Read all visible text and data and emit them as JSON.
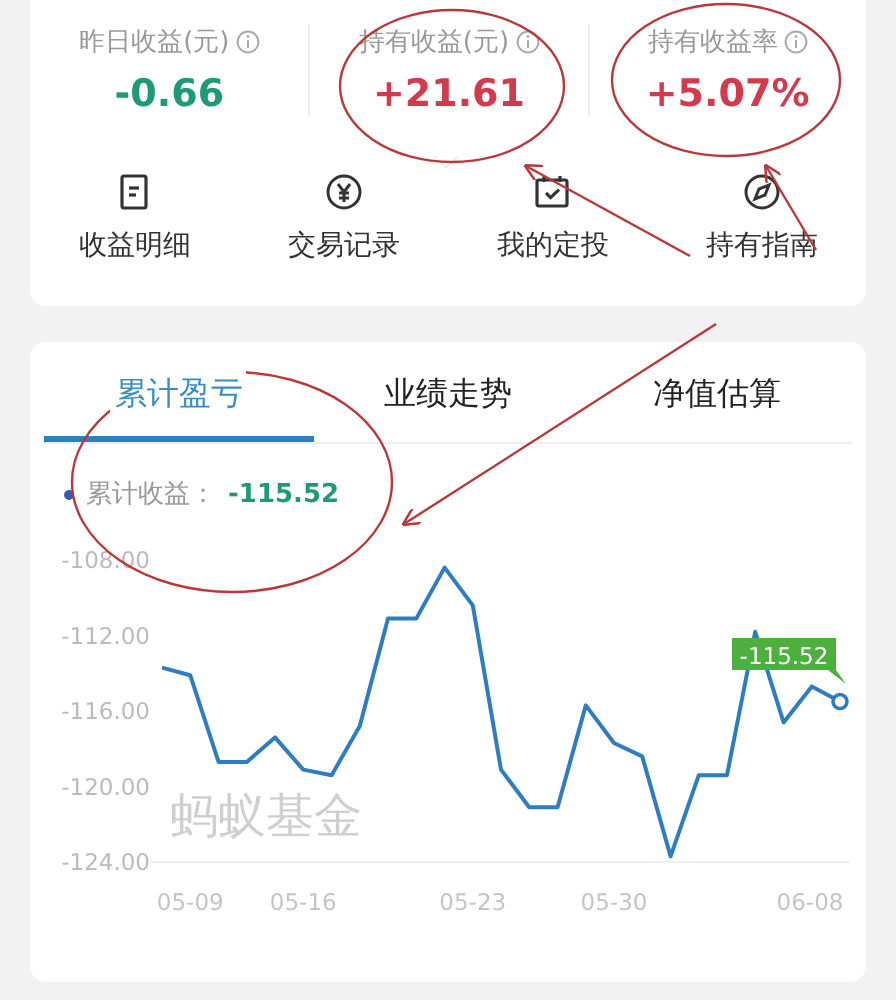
{
  "summary": [
    {
      "label": "昨日收益(元)",
      "value": "-0.66",
      "color": "#1f9a78"
    },
    {
      "label": "持有收益(元)",
      "value": "+21.61",
      "color": "#d23a4e"
    },
    {
      "label": "持有收益率",
      "value": "+5.07%",
      "color": "#d23a4e"
    }
  ],
  "actions": [
    {
      "label": "收益明细",
      "kind": "document"
    },
    {
      "label": "交易记录",
      "kind": "yen"
    },
    {
      "label": "我的定投",
      "kind": "calendar"
    },
    {
      "label": "持有指南",
      "kind": "compass"
    }
  ],
  "tabs": [
    {
      "label": "累计盈亏",
      "selected": true
    },
    {
      "label": "业绩走势",
      "selected": false
    },
    {
      "label": "净值估算",
      "selected": false
    }
  ],
  "legend": {
    "label": "累计收益：",
    "value": "-115.52"
  },
  "chart": {
    "watermark": "蚂蚁基金",
    "tooltip": "-115.52",
    "chart_data": {
      "type": "line",
      "categories": [
        null,
        "05-09",
        null,
        null,
        null,
        "05-16",
        null,
        null,
        null,
        null,
        null,
        "05-23",
        null,
        null,
        null,
        null,
        "05-30",
        null,
        null,
        null,
        null,
        null,
        null,
        "06-08",
        null
      ],
      "series": [
        {
          "color": "#2f7dc0",
          "values": [
            -113.7,
            -114.1,
            -118.7,
            -118.7,
            -117.4,
            -119.1,
            -119.4,
            -116.8,
            -111.1,
            -111.1,
            -108.4,
            -110.4,
            -119.1,
            -121.1,
            -121.1,
            -115.7,
            -117.7,
            -118.4,
            -123.7,
            -119.4,
            -119.4,
            -111.8,
            -116.6,
            -114.7,
            -115.5
          ]
        }
      ],
      "ylim": [
        -124,
        -108
      ],
      "yticks": [
        {
          "value": -108,
          "label": "-108.00"
        },
        {
          "value": -112,
          "label": "-112.00"
        },
        {
          "value": -116,
          "label": "-116.00"
        },
        {
          "value": -120,
          "label": "-120.00"
        },
        {
          "value": -124,
          "label": "-124.00"
        }
      ]
    }
  }
}
